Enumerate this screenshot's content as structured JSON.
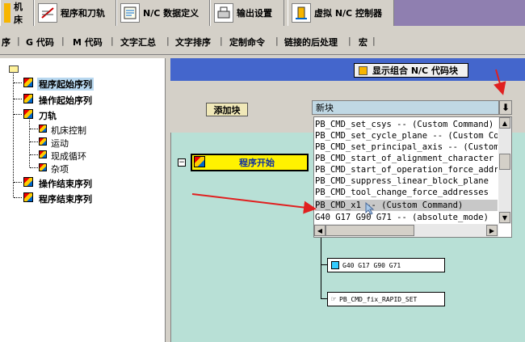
{
  "top_tabs": [
    {
      "label": "机床",
      "icon": "machine-icon"
    },
    {
      "label": "程序和刀轨",
      "icon": "program-icon"
    },
    {
      "label": "N/C 数据定义",
      "icon": "nc-data-icon"
    },
    {
      "label": "输出设置",
      "icon": "printer-icon"
    },
    {
      "label": "虚拟 N/C 控制器",
      "icon": "virtual-nc-icon"
    }
  ],
  "sub_tabs": [
    "序",
    "G 代码",
    "M 代码",
    "文字汇总",
    "文字排序",
    "定制命令",
    "链接的后处理",
    "宏"
  ],
  "tree": {
    "items": [
      {
        "label": "程序起始序列",
        "selected": true
      },
      {
        "label": "操作起始序列"
      },
      {
        "label": "刀轨"
      },
      {
        "label": "机床控制"
      },
      {
        "label": "运动"
      },
      {
        "label": "现成循环"
      },
      {
        "label": "杂项"
      },
      {
        "label": "操作结束序列"
      },
      {
        "label": "程序结束序列"
      }
    ]
  },
  "work": {
    "show_nc_label": "显示组合 N/C 代码块",
    "add_block_label": "添加块",
    "new_block_value": "新块",
    "dropdown_items": [
      "PB_CMD_set_csys -- (Custom Command)",
      "PB_CMD_set_cycle_plane -- (Custom Command)",
      "PB_CMD_set_principal_axis -- (Custom Command)",
      "PB_CMD_start_of_alignment_character",
      "PB_CMD_start_of_operation_force_addresses",
      "PB_CMD_suppress_linear_block_plane",
      "PB_CMD_tool_change_force_addresses",
      "PB_CMD_x1 -- (Custom Command)",
      "G40 G17 G90 G71 -- (absolute_mode)"
    ],
    "selected_index": 7,
    "program_start_label": "程序开始",
    "op1_label": "G40 G17 G90 G71",
    "op2_label": "PB_CMD_fix_RAPID_SET"
  }
}
